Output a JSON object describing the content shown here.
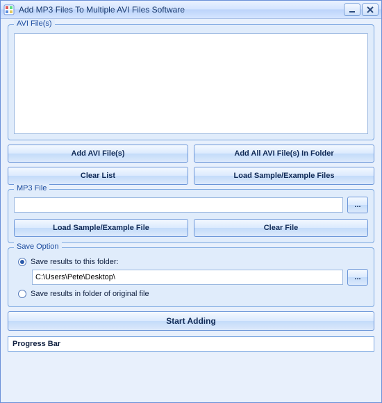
{
  "titlebar": {
    "title": "Add MP3 Files To Multiple AVI Files Software"
  },
  "avi": {
    "legend": "AVI File(s)",
    "add_btn": "Add AVI File(s)",
    "add_all_btn": "Add All AVI File(s) In Folder",
    "clear_btn": "Clear List",
    "load_sample_btn": "Load Sample/Example Files"
  },
  "mp3": {
    "legend": "MP3 File",
    "path": "",
    "browse_btn": "...",
    "load_sample_btn": "Load Sample/Example File",
    "clear_btn": "Clear File"
  },
  "save": {
    "legend": "Save Option",
    "opt_folder_label": "Save results to this folder:",
    "folder_path": "C:\\Users\\Pete\\Desktop\\",
    "browse_btn": "...",
    "opt_original_label": "Save results in folder of original file",
    "selected": "folder"
  },
  "action": {
    "start_btn": "Start Adding"
  },
  "progress": {
    "label": "Progress Bar"
  }
}
